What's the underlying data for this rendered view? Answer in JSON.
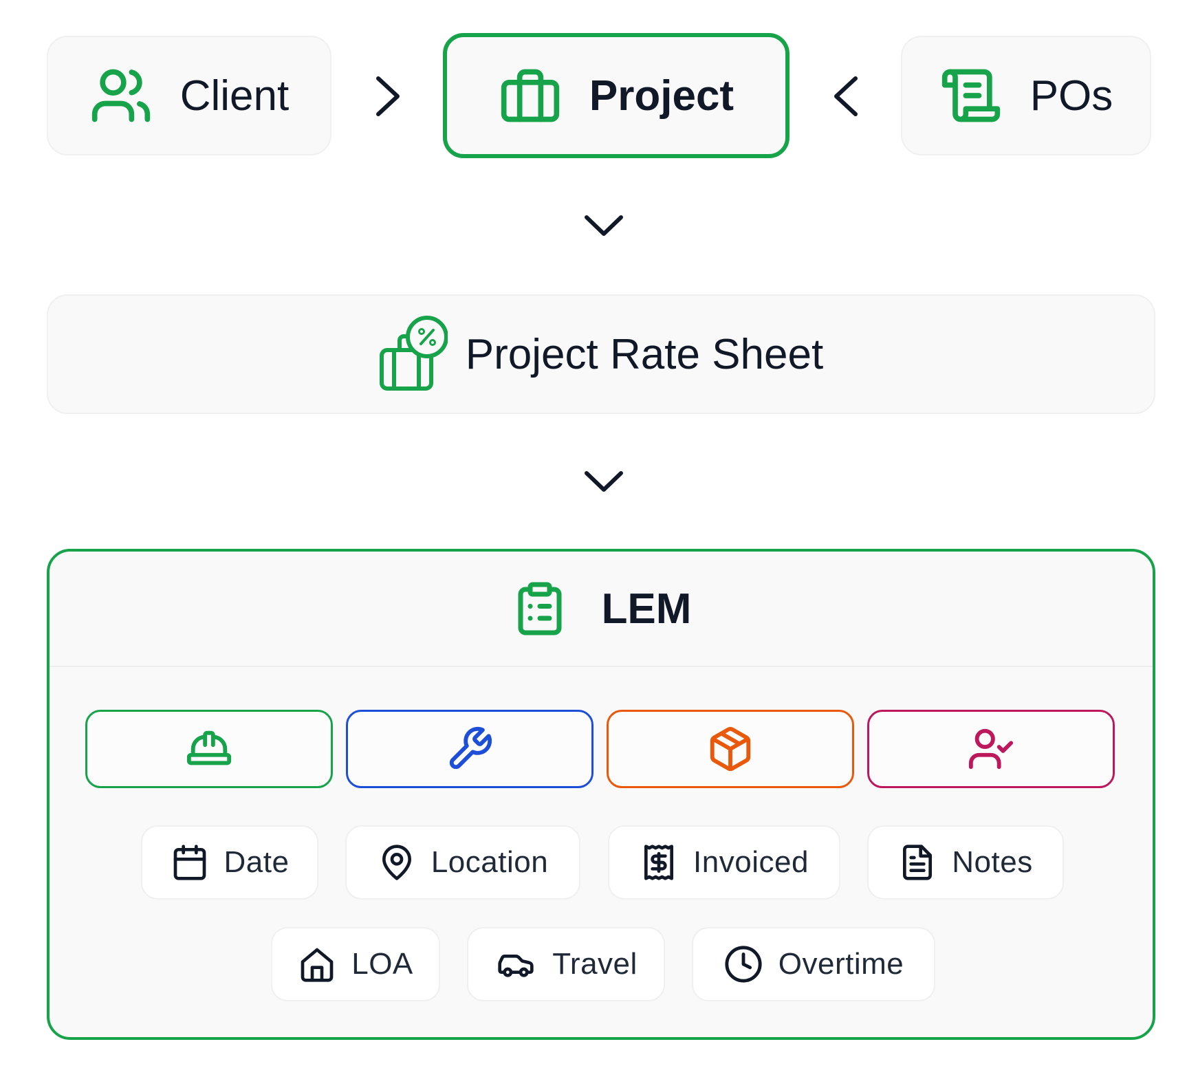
{
  "top_row": {
    "client": {
      "label": "Client",
      "icon": "users-icon"
    },
    "project": {
      "label": "Project",
      "icon": "briefcase-icon"
    },
    "pos": {
      "label": "POs",
      "icon": "scroll-icon"
    }
  },
  "rate_sheet": {
    "label": "Project Rate Sheet",
    "icon": "briefcase-percent-icon"
  },
  "lem": {
    "label": "LEM",
    "icon": "clipboard-list-icon",
    "categories": [
      {
        "icon": "hard-hat-icon",
        "color": "#16a34a"
      },
      {
        "icon": "wrench-icon",
        "color": "#1d4ed8"
      },
      {
        "icon": "package-icon",
        "color": "#ea580c"
      },
      {
        "icon": "user-check-icon",
        "color": "#be185d"
      }
    ],
    "fields": [
      {
        "label": "Date",
        "icon": "calendar-icon"
      },
      {
        "label": "Location",
        "icon": "map-pin-icon"
      },
      {
        "label": "Invoiced",
        "icon": "receipt-icon"
      },
      {
        "label": "Notes",
        "icon": "file-text-icon"
      },
      {
        "label": "LOA",
        "icon": "home-icon"
      },
      {
        "label": "Travel",
        "icon": "car-icon"
      },
      {
        "label": "Overtime",
        "icon": "clock-icon"
      }
    ]
  },
  "colors": {
    "accent": "#16a34a",
    "text": "#111827",
    "card_bg": "#f9f9f9"
  }
}
